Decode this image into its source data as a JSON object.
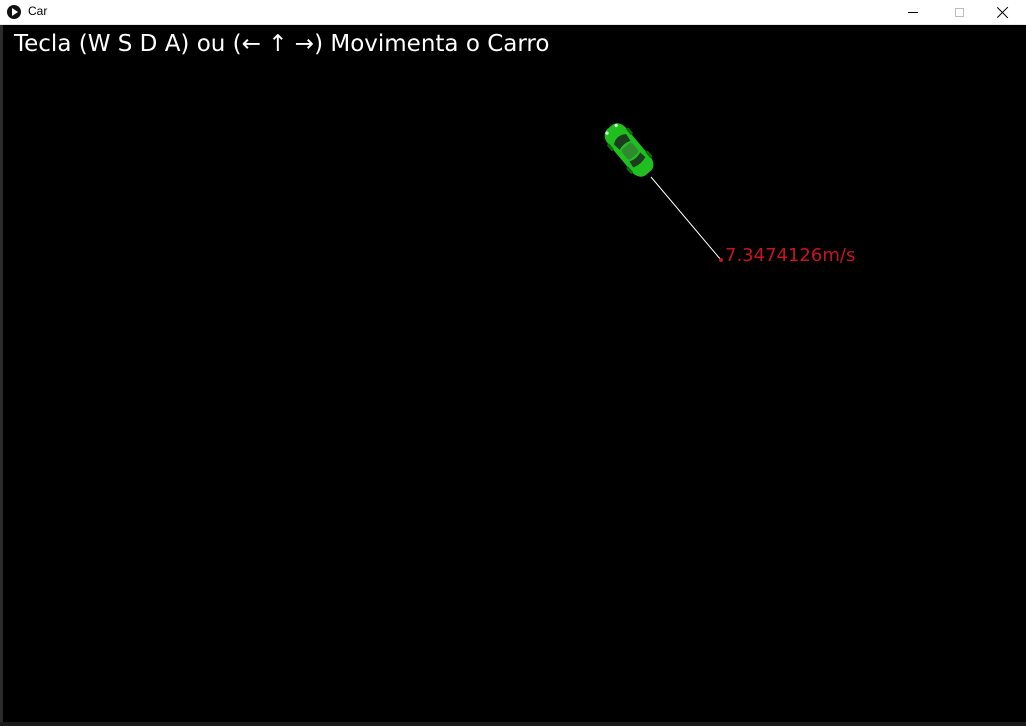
{
  "window": {
    "title": "Car",
    "icon": "play-circle-icon",
    "controls": {
      "minimize_icon": "minimize-icon",
      "maximize_icon": "maximize-icon",
      "close_icon": "close-icon"
    }
  },
  "game": {
    "instructions": "Tecla (W S D A) ou (← ↑ →) Movimenta o Carro",
    "speed_text": "7.3474126m/s",
    "car_color": "#1fbf1f",
    "vector_color": "#ffffff",
    "speed_color": "#c8141e",
    "background": "#000000"
  }
}
